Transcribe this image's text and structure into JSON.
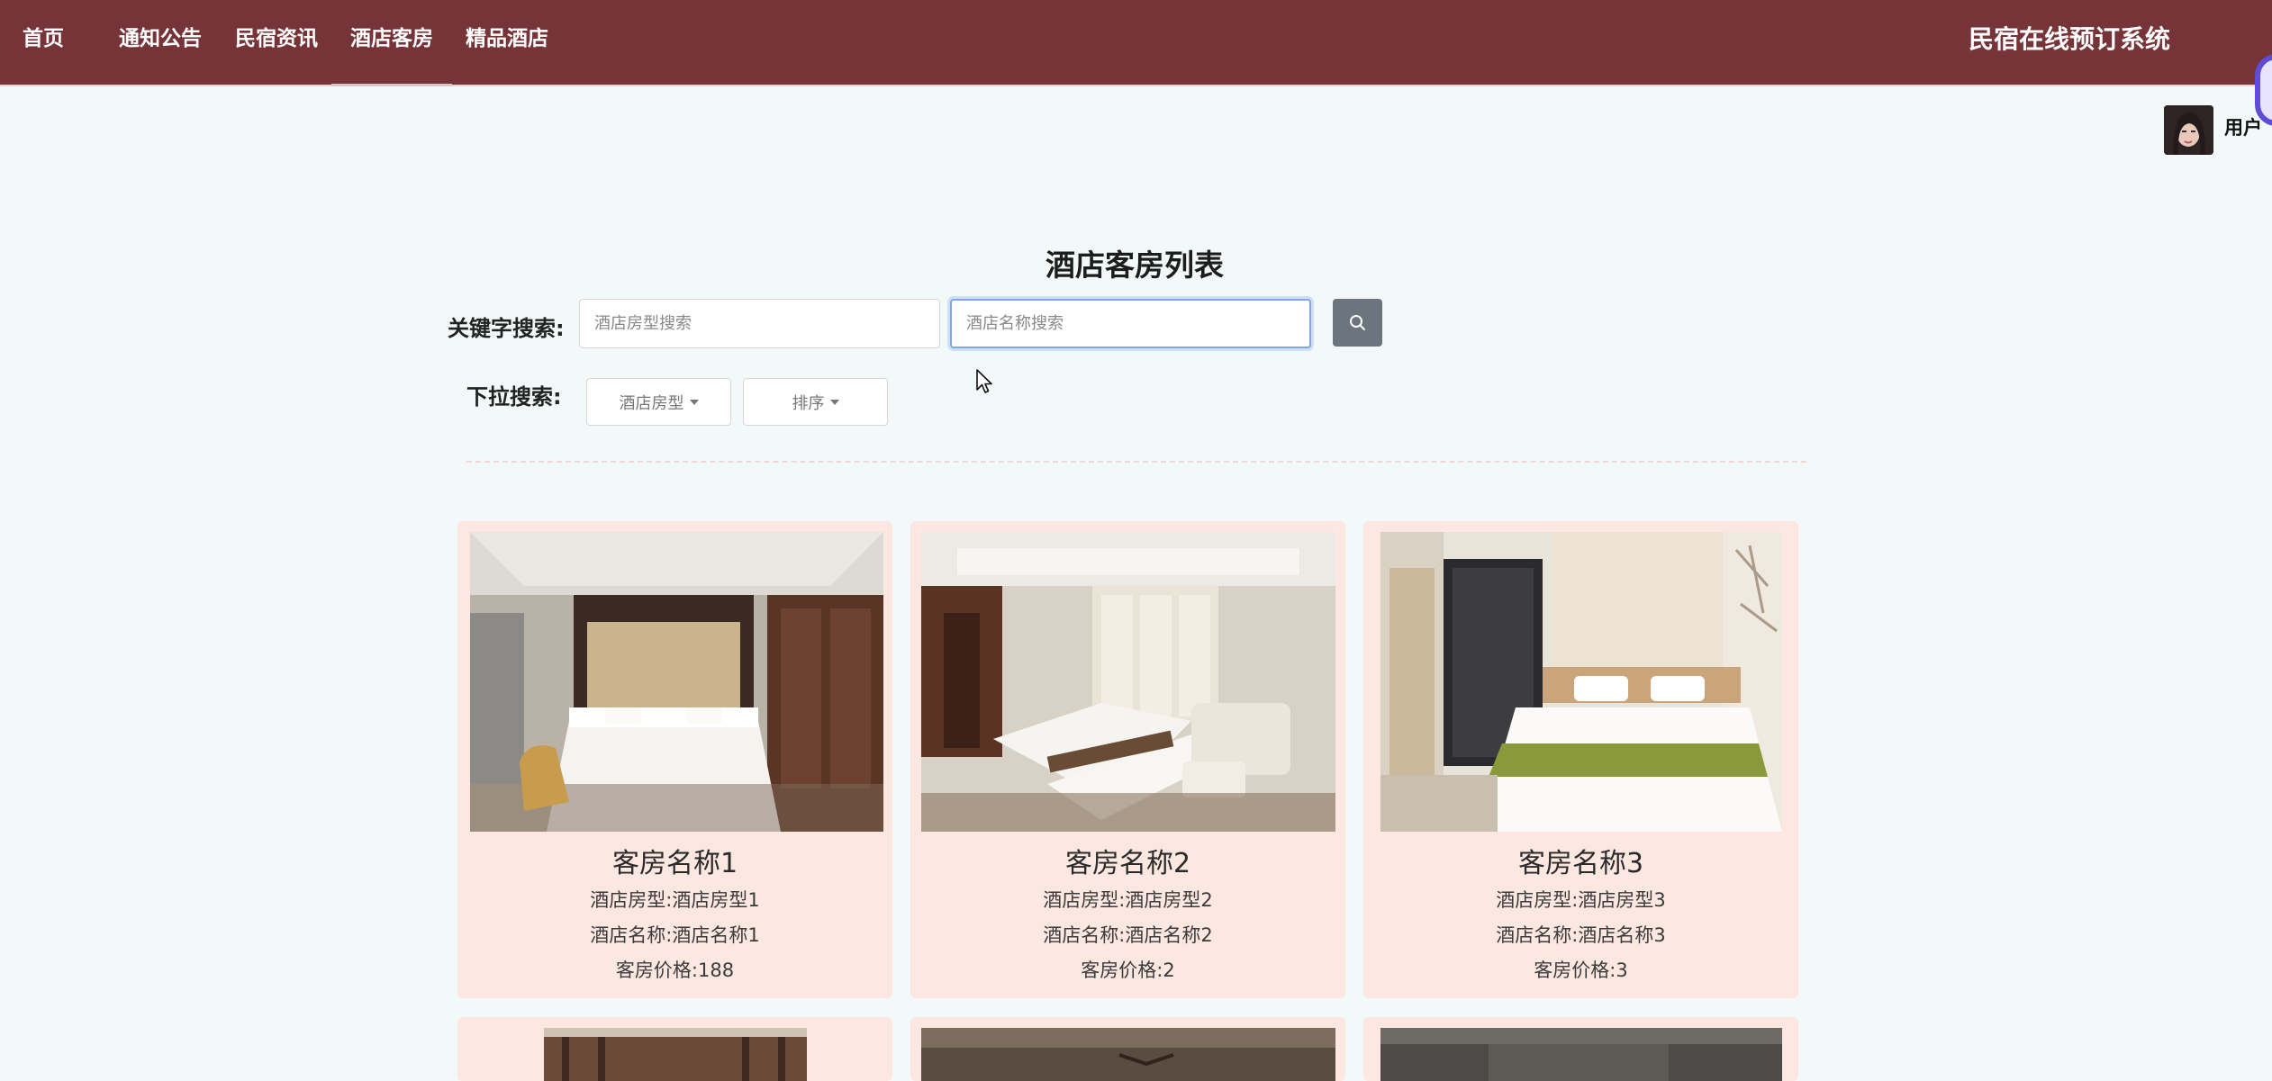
{
  "nav": {
    "items": [
      {
        "label": "首页"
      },
      {
        "label": "通知公告"
      },
      {
        "label": "民宿资讯"
      },
      {
        "label": "酒店客房"
      },
      {
        "label": "精品酒店"
      }
    ],
    "active_index": 3,
    "site_title": "民宿在线预订系统"
  },
  "user": {
    "label": "用户"
  },
  "page": {
    "title": "酒店客房列表"
  },
  "search": {
    "keyword_label": "关键字搜索:",
    "room_type_placeholder": "酒店房型搜索",
    "hotel_name_placeholder": "酒店名称搜索",
    "dropdown_label": "下拉搜索:",
    "room_type_dropdown": "酒店房型",
    "sort_dropdown": "排序",
    "search_icon": "search-icon"
  },
  "rooms": [
    {
      "name": "客房名称1",
      "room_type": "酒店房型:酒店房型1",
      "hotel_name": "酒店名称:酒店名称1",
      "price": "客房价格:188"
    },
    {
      "name": "客房名称2",
      "room_type": "酒店房型:酒店房型2",
      "hotel_name": "酒店名称:酒店名称2",
      "price": "客房价格:2"
    },
    {
      "name": "客房名称3",
      "room_type": "酒店房型:酒店房型3",
      "hotel_name": "酒店名称:酒店名称3",
      "price": "客房价格:3"
    }
  ],
  "colors": {
    "nav_bg": "#763439",
    "page_bg": "#f3f8f8",
    "card_bg": "#fde7e1",
    "search_button": "#6c757d"
  }
}
